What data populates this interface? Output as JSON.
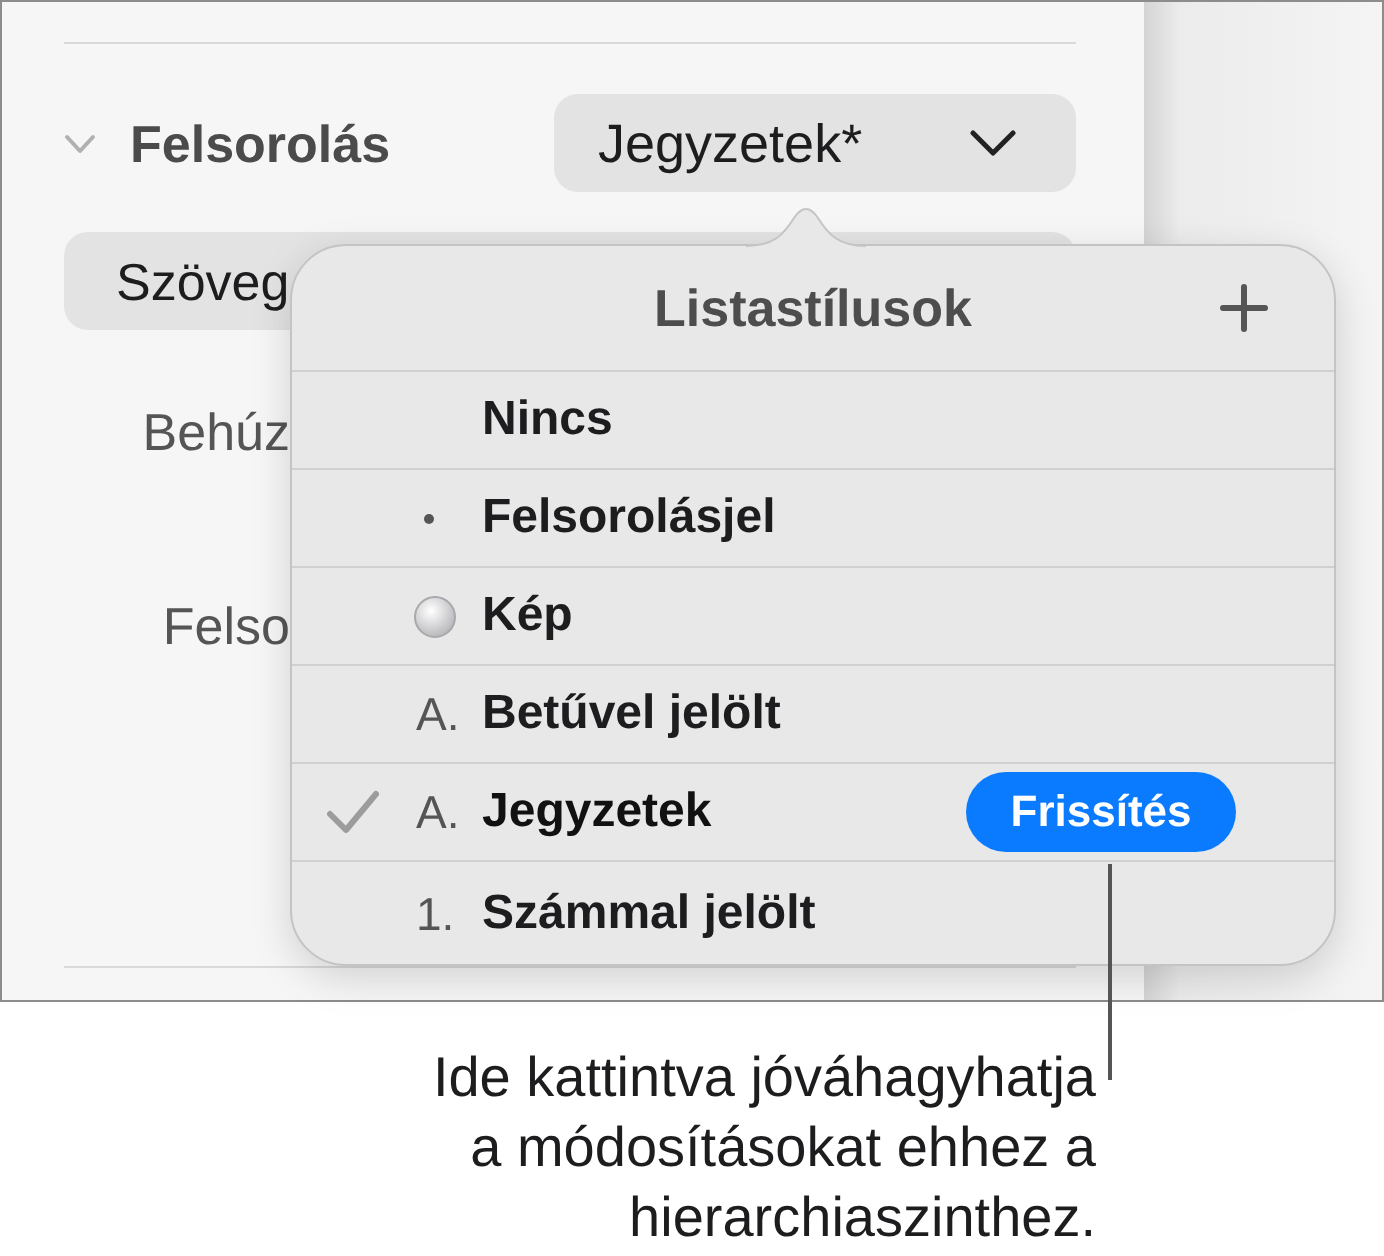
{
  "sidebar": {
    "section": {
      "title": "Felsorolás",
      "expanded": true
    },
    "style_popup": {
      "value": "Jegyzetek*"
    },
    "text_button": {
      "label": "Szöveg"
    },
    "labels": [
      "Behúz",
      "Felso"
    ]
  },
  "popover": {
    "title": "Listastílusok",
    "items": [
      {
        "kind": "none",
        "label": "Nincs",
        "selected": false
      },
      {
        "kind": "bullet",
        "label": "Felsorolásjel",
        "selected": false
      },
      {
        "kind": "image",
        "label": "Kép",
        "selected": false
      },
      {
        "kind": "text",
        "marker": "A.",
        "label": "Betűvel jelölt",
        "selected": false
      },
      {
        "kind": "text",
        "marker": "A.",
        "label": "Jegyzetek",
        "selected": true,
        "action": "Frissítés"
      },
      {
        "kind": "text",
        "marker": "1.",
        "label": "Számmal jelölt",
        "selected": false
      }
    ]
  },
  "callout": {
    "lines": [
      "Ide kattintva jóváhagyhatja",
      "a módosításokat ehhez a",
      "hierarchiaszinthez."
    ]
  }
}
